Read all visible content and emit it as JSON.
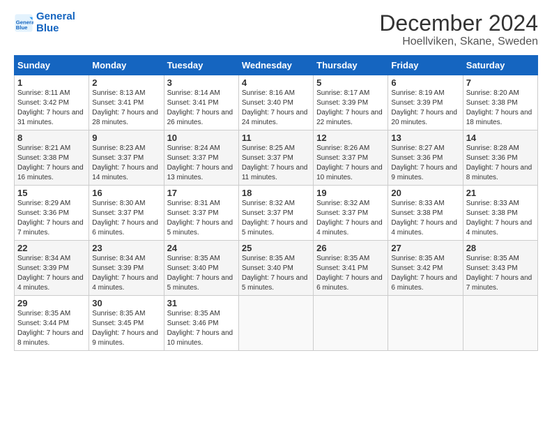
{
  "header": {
    "logo_line1": "General",
    "logo_line2": "Blue",
    "title": "December 2024",
    "subtitle": "Hoellviken, Skane, Sweden"
  },
  "weekdays": [
    "Sunday",
    "Monday",
    "Tuesday",
    "Wednesday",
    "Thursday",
    "Friday",
    "Saturday"
  ],
  "weeks": [
    [
      {
        "day": "1",
        "sunrise": "8:11 AM",
        "sunset": "3:42 PM",
        "daylight": "7 hours and 31 minutes."
      },
      {
        "day": "2",
        "sunrise": "8:13 AM",
        "sunset": "3:41 PM",
        "daylight": "7 hours and 28 minutes."
      },
      {
        "day": "3",
        "sunrise": "8:14 AM",
        "sunset": "3:41 PM",
        "daylight": "7 hours and 26 minutes."
      },
      {
        "day": "4",
        "sunrise": "8:16 AM",
        "sunset": "3:40 PM",
        "daylight": "7 hours and 24 minutes."
      },
      {
        "day": "5",
        "sunrise": "8:17 AM",
        "sunset": "3:39 PM",
        "daylight": "7 hours and 22 minutes."
      },
      {
        "day": "6",
        "sunrise": "8:19 AM",
        "sunset": "3:39 PM",
        "daylight": "7 hours and 20 minutes."
      },
      {
        "day": "7",
        "sunrise": "8:20 AM",
        "sunset": "3:38 PM",
        "daylight": "7 hours and 18 minutes."
      }
    ],
    [
      {
        "day": "8",
        "sunrise": "8:21 AM",
        "sunset": "3:38 PM",
        "daylight": "7 hours and 16 minutes."
      },
      {
        "day": "9",
        "sunrise": "8:23 AM",
        "sunset": "3:37 PM",
        "daylight": "7 hours and 14 minutes."
      },
      {
        "day": "10",
        "sunrise": "8:24 AM",
        "sunset": "3:37 PM",
        "daylight": "7 hours and 13 minutes."
      },
      {
        "day": "11",
        "sunrise": "8:25 AM",
        "sunset": "3:37 PM",
        "daylight": "7 hours and 11 minutes."
      },
      {
        "day": "12",
        "sunrise": "8:26 AM",
        "sunset": "3:37 PM",
        "daylight": "7 hours and 10 minutes."
      },
      {
        "day": "13",
        "sunrise": "8:27 AM",
        "sunset": "3:36 PM",
        "daylight": "7 hours and 9 minutes."
      },
      {
        "day": "14",
        "sunrise": "8:28 AM",
        "sunset": "3:36 PM",
        "daylight": "7 hours and 8 minutes."
      }
    ],
    [
      {
        "day": "15",
        "sunrise": "8:29 AM",
        "sunset": "3:36 PM",
        "daylight": "7 hours and 7 minutes."
      },
      {
        "day": "16",
        "sunrise": "8:30 AM",
        "sunset": "3:37 PM",
        "daylight": "7 hours and 6 minutes."
      },
      {
        "day": "17",
        "sunrise": "8:31 AM",
        "sunset": "3:37 PM",
        "daylight": "7 hours and 5 minutes."
      },
      {
        "day": "18",
        "sunrise": "8:32 AM",
        "sunset": "3:37 PM",
        "daylight": "7 hours and 5 minutes."
      },
      {
        "day": "19",
        "sunrise": "8:32 AM",
        "sunset": "3:37 PM",
        "daylight": "7 hours and 4 minutes."
      },
      {
        "day": "20",
        "sunrise": "8:33 AM",
        "sunset": "3:38 PM",
        "daylight": "7 hours and 4 minutes."
      },
      {
        "day": "21",
        "sunrise": "8:33 AM",
        "sunset": "3:38 PM",
        "daylight": "7 hours and 4 minutes."
      }
    ],
    [
      {
        "day": "22",
        "sunrise": "8:34 AM",
        "sunset": "3:39 PM",
        "daylight": "7 hours and 4 minutes."
      },
      {
        "day": "23",
        "sunrise": "8:34 AM",
        "sunset": "3:39 PM",
        "daylight": "7 hours and 4 minutes."
      },
      {
        "day": "24",
        "sunrise": "8:35 AM",
        "sunset": "3:40 PM",
        "daylight": "7 hours and 5 minutes."
      },
      {
        "day": "25",
        "sunrise": "8:35 AM",
        "sunset": "3:40 PM",
        "daylight": "7 hours and 5 minutes."
      },
      {
        "day": "26",
        "sunrise": "8:35 AM",
        "sunset": "3:41 PM",
        "daylight": "7 hours and 6 minutes."
      },
      {
        "day": "27",
        "sunrise": "8:35 AM",
        "sunset": "3:42 PM",
        "daylight": "7 hours and 6 minutes."
      },
      {
        "day": "28",
        "sunrise": "8:35 AM",
        "sunset": "3:43 PM",
        "daylight": "7 hours and 7 minutes."
      }
    ],
    [
      {
        "day": "29",
        "sunrise": "8:35 AM",
        "sunset": "3:44 PM",
        "daylight": "7 hours and 8 minutes."
      },
      {
        "day": "30",
        "sunrise": "8:35 AM",
        "sunset": "3:45 PM",
        "daylight": "7 hours and 9 minutes."
      },
      {
        "day": "31",
        "sunrise": "8:35 AM",
        "sunset": "3:46 PM",
        "daylight": "7 hours and 10 minutes."
      },
      null,
      null,
      null,
      null
    ]
  ]
}
